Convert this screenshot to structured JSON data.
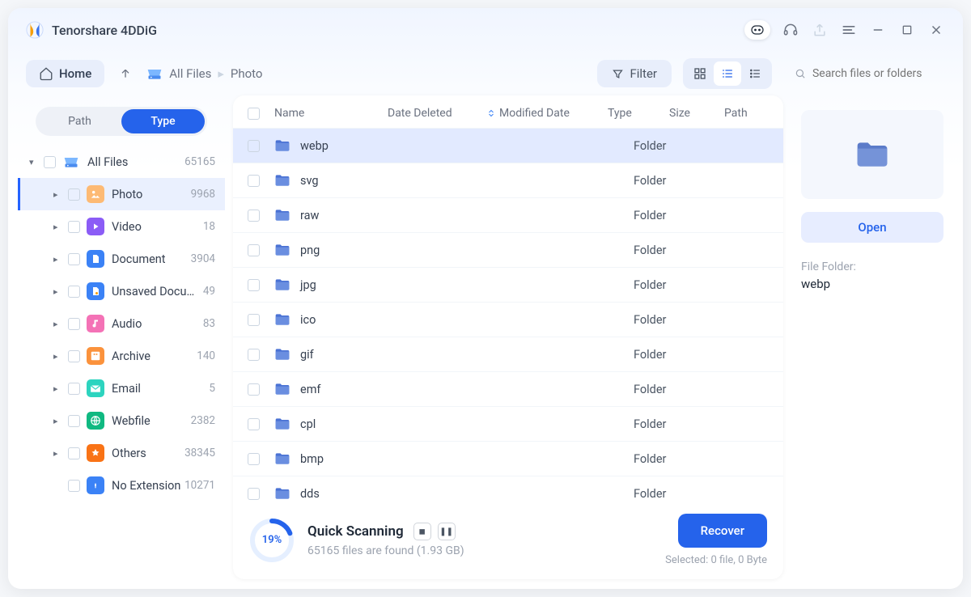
{
  "app": {
    "title": "Tenorshare 4DDiG"
  },
  "toolbar": {
    "home": "Home",
    "filter": "Filter",
    "breadcrumb": [
      "All Files",
      "Photo"
    ],
    "search_placeholder": "Search files or folders"
  },
  "sidebar": {
    "tabs": {
      "path": "Path",
      "type": "Type"
    },
    "root": {
      "label": "All Files",
      "count": "65165"
    },
    "items": [
      {
        "label": "Photo",
        "count": "9968",
        "icon": "#FDBA74"
      },
      {
        "label": "Video",
        "count": "18",
        "icon": "#8B5CF6"
      },
      {
        "label": "Document",
        "count": "3904",
        "icon": "#3B82F6"
      },
      {
        "label": "Unsaved Docum...",
        "count": "49",
        "icon": "#3B82F6"
      },
      {
        "label": "Audio",
        "count": "83",
        "icon": "#F472B6"
      },
      {
        "label": "Archive",
        "count": "140",
        "icon": "#FB923C"
      },
      {
        "label": "Email",
        "count": "5",
        "icon": "#2DD4BF"
      },
      {
        "label": "Webfile",
        "count": "2382",
        "icon": "#10B981"
      },
      {
        "label": "Others",
        "count": "38345",
        "icon": "#F97316"
      },
      {
        "label": "No Extension",
        "count": "10271",
        "icon": "#3B82F6"
      }
    ]
  },
  "columns": {
    "name": "Name",
    "deleted": "Date Deleted",
    "modified": "Modified Date",
    "type": "Type",
    "size": "Size",
    "path": "Path"
  },
  "rows": [
    {
      "name": "webp",
      "type": "Folder"
    },
    {
      "name": "svg",
      "type": "Folder"
    },
    {
      "name": "raw",
      "type": "Folder"
    },
    {
      "name": "png",
      "type": "Folder"
    },
    {
      "name": "jpg",
      "type": "Folder"
    },
    {
      "name": "ico",
      "type": "Folder"
    },
    {
      "name": "gif",
      "type": "Folder"
    },
    {
      "name": "emf",
      "type": "Folder"
    },
    {
      "name": "cpl",
      "type": "Folder"
    },
    {
      "name": "bmp",
      "type": "Folder"
    },
    {
      "name": "dds",
      "type": "Folder"
    }
  ],
  "scan": {
    "percent": "19%",
    "percent_num": 19,
    "title": "Quick Scanning",
    "sub": "65165 files are found (1.93 GB)"
  },
  "detail": {
    "open": "Open",
    "label": "File Folder:",
    "value": "webp"
  },
  "footer": {
    "recover": "Recover",
    "selected": "Selected: 0 file, 0 Byte"
  }
}
